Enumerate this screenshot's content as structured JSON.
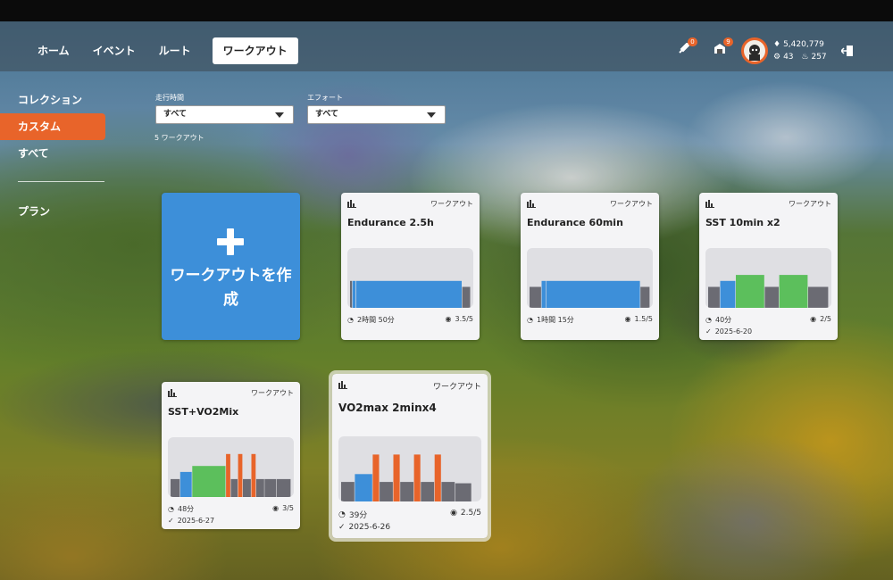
{
  "nav": {
    "items": [
      {
        "label": "ホーム"
      },
      {
        "label": "イベント"
      },
      {
        "label": "ルート"
      },
      {
        "label": "ワークアウト",
        "active": true
      }
    ]
  },
  "header": {
    "badge_1": "0",
    "badge_2": "9",
    "stat_points": "5,420,779",
    "stat_level": "43",
    "stat_streak": "257"
  },
  "sidebar": {
    "items": [
      {
        "label": "コレクション"
      },
      {
        "label": "カスタム",
        "active": true
      },
      {
        "label": "すべて"
      },
      {
        "label": "プラン"
      }
    ]
  },
  "filters": {
    "duration_label": "走行時間",
    "duration_value": "すべて",
    "effort_label": "エフォート",
    "effort_value": "すべて"
  },
  "workout_count": "5 ワークアウト",
  "create_label": "ワークアウトを作成",
  "colors": {
    "accent": "#e8642a",
    "create": "#3d8fd9",
    "blue": "#3d8fd9",
    "green": "#5cbf5c",
    "orange": "#e8642a",
    "gray": "#6b6b73"
  },
  "workouts": [
    {
      "type_label": "ワークアウト",
      "title": "Endurance 2.5h",
      "duration": "2時間 50分",
      "rating": "3.5/5",
      "date": "",
      "segments": [
        [
          0.02,
          0.45,
          "gray"
        ],
        [
          0.03,
          0.45,
          "blue"
        ],
        [
          0.88,
          0.45,
          "blue"
        ],
        [
          0.07,
          0.35,
          "gray"
        ]
      ]
    },
    {
      "type_label": "ワークアウト",
      "title": "Endurance 60min",
      "duration": "1時間 15分",
      "rating": "1.5/5",
      "date": "",
      "segments": [
        [
          0.1,
          0.35,
          "gray"
        ],
        [
          0.04,
          0.45,
          "blue"
        ],
        [
          0.78,
          0.45,
          "blue"
        ],
        [
          0.08,
          0.35,
          "gray"
        ]
      ]
    },
    {
      "type_label": "ワークアウト",
      "title": "SST 10min x2",
      "duration": "40分",
      "rating": "2/5",
      "date": "2025-6-20",
      "segments": [
        [
          0.1,
          0.35,
          "gray"
        ],
        [
          0.13,
          0.45,
          "blue"
        ],
        [
          0.24,
          0.55,
          "green"
        ],
        [
          0.12,
          0.35,
          "gray"
        ],
        [
          0.24,
          0.55,
          "green"
        ],
        [
          0.17,
          0.35,
          "gray"
        ]
      ]
    },
    {
      "type_label": "ワークアウト",
      "title": "SST+VO2Mix",
      "duration": "48分",
      "rating": "3/5",
      "date": "2025-6-27",
      "segments": [
        [
          0.08,
          0.3,
          "gray"
        ],
        [
          0.1,
          0.42,
          "blue"
        ],
        [
          0.28,
          0.52,
          "green"
        ],
        [
          0.04,
          0.72,
          "orange"
        ],
        [
          0.06,
          0.3,
          "gray"
        ],
        [
          0.04,
          0.72,
          "orange"
        ],
        [
          0.07,
          0.3,
          "gray"
        ],
        [
          0.04,
          0.72,
          "orange"
        ],
        [
          0.07,
          0.3,
          "gray"
        ],
        [
          0.1,
          0.3,
          "gray"
        ],
        [
          0.12,
          0.3,
          "gray"
        ]
      ]
    },
    {
      "type_label": "ワークアウト",
      "title": "VO2max 2minx4",
      "duration": "39分",
      "rating": "2.5/5",
      "date": "2025-6-26",
      "segments": [
        [
          0.1,
          0.3,
          "gray"
        ],
        [
          0.13,
          0.42,
          "blue"
        ],
        [
          0.05,
          0.72,
          "orange"
        ],
        [
          0.1,
          0.3,
          "gray"
        ],
        [
          0.05,
          0.72,
          "orange"
        ],
        [
          0.1,
          0.3,
          "gray"
        ],
        [
          0.05,
          0.72,
          "orange"
        ],
        [
          0.1,
          0.3,
          "gray"
        ],
        [
          0.05,
          0.72,
          "orange"
        ],
        [
          0.1,
          0.3,
          "gray"
        ],
        [
          0.12,
          0.28,
          "gray"
        ]
      ]
    }
  ]
}
